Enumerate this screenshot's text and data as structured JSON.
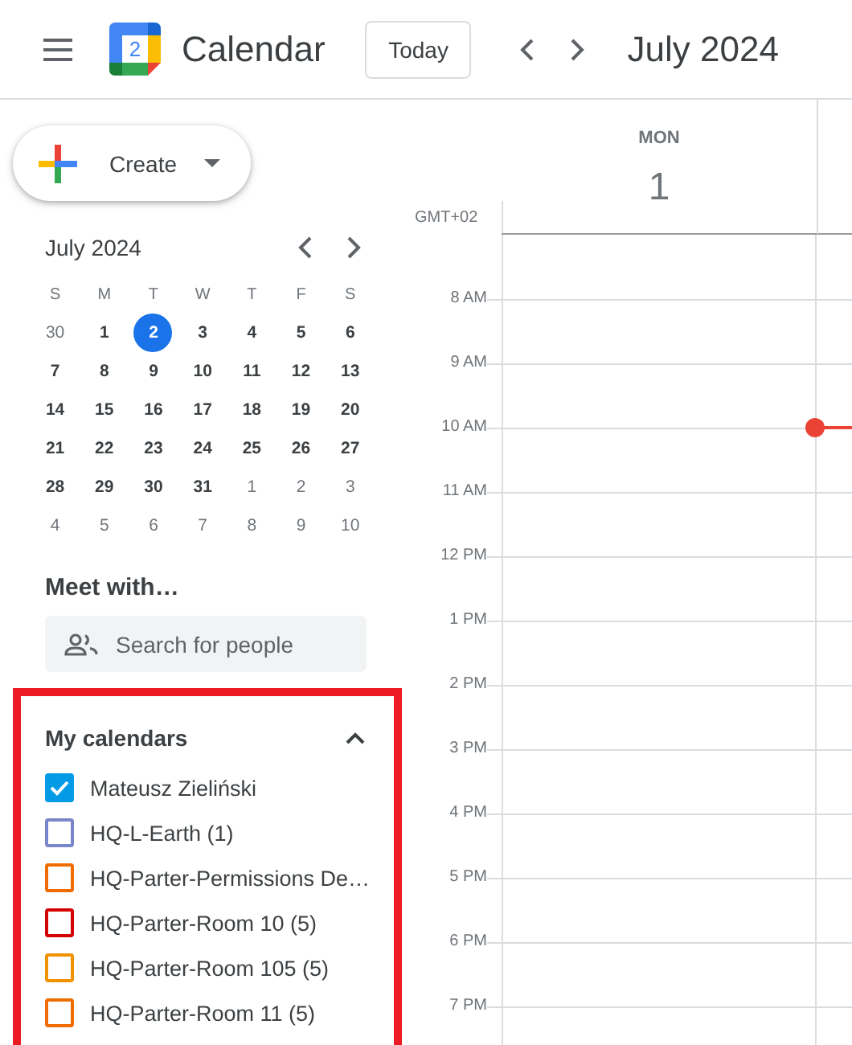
{
  "header": {
    "app_name": "Calendar",
    "logo_day": "2",
    "today_button": "Today",
    "period": "July 2024"
  },
  "create_button": {
    "label": "Create"
  },
  "mini_calendar": {
    "title": "July 2024",
    "weekdays": [
      "S",
      "M",
      "T",
      "W",
      "T",
      "F",
      "S"
    ],
    "days": [
      {
        "label": "30",
        "selected": false,
        "muted": true
      },
      {
        "label": "1",
        "selected": false,
        "muted": false
      },
      {
        "label": "2",
        "selected": true,
        "muted": false
      },
      {
        "label": "3",
        "selected": false,
        "muted": false
      },
      {
        "label": "4",
        "selected": false,
        "muted": false
      },
      {
        "label": "5",
        "selected": false,
        "muted": false
      },
      {
        "label": "6",
        "selected": false,
        "muted": false
      },
      {
        "label": "7",
        "selected": false,
        "muted": false
      },
      {
        "label": "8",
        "selected": false,
        "muted": false
      },
      {
        "label": "9",
        "selected": false,
        "muted": false
      },
      {
        "label": "10",
        "selected": false,
        "muted": false
      },
      {
        "label": "11",
        "selected": false,
        "muted": false
      },
      {
        "label": "12",
        "selected": false,
        "muted": false
      },
      {
        "label": "13",
        "selected": false,
        "muted": false
      },
      {
        "label": "14",
        "selected": false,
        "muted": false
      },
      {
        "label": "15",
        "selected": false,
        "muted": false
      },
      {
        "label": "16",
        "selected": false,
        "muted": false
      },
      {
        "label": "17",
        "selected": false,
        "muted": false
      },
      {
        "label": "18",
        "selected": false,
        "muted": false
      },
      {
        "label": "19",
        "selected": false,
        "muted": false
      },
      {
        "label": "20",
        "selected": false,
        "muted": false
      },
      {
        "label": "21",
        "selected": false,
        "muted": false
      },
      {
        "label": "22",
        "selected": false,
        "muted": false
      },
      {
        "label": "23",
        "selected": false,
        "muted": false
      },
      {
        "label": "24",
        "selected": false,
        "muted": false
      },
      {
        "label": "25",
        "selected": false,
        "muted": false
      },
      {
        "label": "26",
        "selected": false,
        "muted": false
      },
      {
        "label": "27",
        "selected": false,
        "muted": false
      },
      {
        "label": "28",
        "selected": false,
        "muted": false
      },
      {
        "label": "29",
        "selected": false,
        "muted": false
      },
      {
        "label": "30",
        "selected": false,
        "muted": false
      },
      {
        "label": "31",
        "selected": false,
        "muted": false
      },
      {
        "label": "1",
        "selected": false,
        "muted": true
      },
      {
        "label": "2",
        "selected": false,
        "muted": true
      },
      {
        "label": "3",
        "selected": false,
        "muted": true
      },
      {
        "label": "4",
        "selected": false,
        "muted": true
      },
      {
        "label": "5",
        "selected": false,
        "muted": true
      },
      {
        "label": "6",
        "selected": false,
        "muted": true
      },
      {
        "label": "7",
        "selected": false,
        "muted": true
      },
      {
        "label": "8",
        "selected": false,
        "muted": true
      },
      {
        "label": "9",
        "selected": false,
        "muted": true
      },
      {
        "label": "10",
        "selected": false,
        "muted": true
      }
    ]
  },
  "meet_with": {
    "title": "Meet with…",
    "search": {
      "placeholder": "Search for people"
    }
  },
  "my_calendars": {
    "title": "My calendars",
    "expanded": true,
    "highlighted": true,
    "items": [
      {
        "name": "Mateusz Zieliński",
        "checked": true,
        "color": "#039be5"
      },
      {
        "name": "HQ-L-Earth (1)",
        "checked": false,
        "color": "#7986cb"
      },
      {
        "name": "HQ-Parter-Permissions De…",
        "checked": false,
        "color": "#ef6c00"
      },
      {
        "name": "HQ-Parter-Room 10 (5)",
        "checked": false,
        "color": "#d50000"
      },
      {
        "name": "HQ-Parter-Room 105 (5)",
        "checked": false,
        "color": "#f09300"
      },
      {
        "name": "HQ-Parter-Room 11 (5)",
        "checked": false,
        "color": "#ef6c00"
      }
    ]
  },
  "day_view": {
    "weekday": "MON",
    "date": "1",
    "timezone": "GMT+02",
    "hours": [
      {
        "label": "8 AM",
        "current_time": false
      },
      {
        "label": "9 AM",
        "current_time": false
      },
      {
        "label": "10 AM",
        "current_time": true
      },
      {
        "label": "11 AM",
        "current_time": false
      },
      {
        "label": "12 PM",
        "current_time": false
      },
      {
        "label": "1 PM",
        "current_time": false
      },
      {
        "label": "2 PM",
        "current_time": false
      },
      {
        "label": "3 PM",
        "current_time": false
      },
      {
        "label": "4 PM",
        "current_time": false
      },
      {
        "label": "5 PM",
        "current_time": false
      },
      {
        "label": "6 PM",
        "current_time": false
      },
      {
        "label": "7 PM",
        "current_time": false
      }
    ]
  }
}
